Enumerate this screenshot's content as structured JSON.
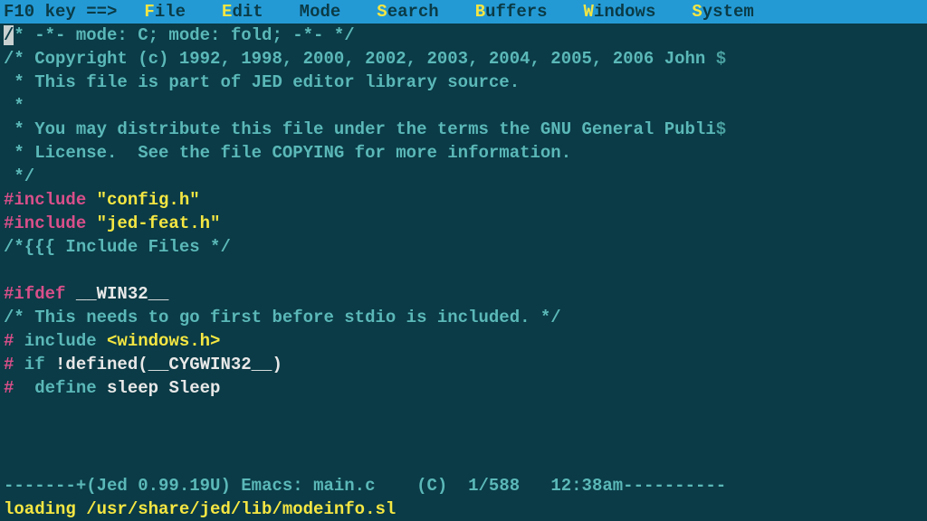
{
  "menubar": {
    "prompt": "F10 key ==>",
    "items": [
      {
        "hl": "F",
        "rest": "ile"
      },
      {
        "hl": "E",
        "rest": "dit"
      },
      {
        "hl": "",
        "rest": "Mode"
      },
      {
        "hl": "S",
        "rest": "earch"
      },
      {
        "hl": "B",
        "rest": "uffers"
      },
      {
        "hl": "W",
        "rest": "indows"
      },
      {
        "hl": "S",
        "rest": "ystem"
      }
    ]
  },
  "code": {
    "l1a": "/",
    "l1b": "* -*- mode: C; mode: fold; -*- */",
    "l2a": "/* Copyright (c) 1992, 1998, 2000, 2002, 2003, 2004, 2005, 2006 John ",
    "l2b": "$",
    "l3": " * This file is part of JED editor library source.",
    "l4": " *",
    "l5a": " * You may distribute this file under the terms the GNU General Publi",
    "l5b": "$",
    "l6": " * License.  See the file COPYING for more information.",
    "l7": " */",
    "l8a": "#include",
    "l8b": " \"config.h\"",
    "l9a": "#include",
    "l9b": " \"jed-feat.h\"",
    "l10": "/*{{{ Include Files */",
    "l11": " ",
    "l12a": "#ifdef",
    "l12b": " __WIN32__",
    "l13": "/* This needs to go first before stdio is included. */",
    "l14a": "#",
    "l14b": " include ",
    "l14c": "<windows.h>",
    "l15a": "#",
    "l15b": " if ",
    "l15c": "!defined(__CYGWIN32__)",
    "l16a": "#",
    "l16b": "  define ",
    "l16c": "sleep Sleep"
  },
  "status": {
    "pre": "-------+",
    "version": "(Jed 0.99.19U)",
    "mode": " Emacs: ",
    "file": "main.c",
    "lang": "    (C)  ",
    "pos": "1/588",
    "time": "   12:38am",
    "post": "----------"
  },
  "minibuffer": "loading /usr/share/jed/lib/modeinfo.sl"
}
